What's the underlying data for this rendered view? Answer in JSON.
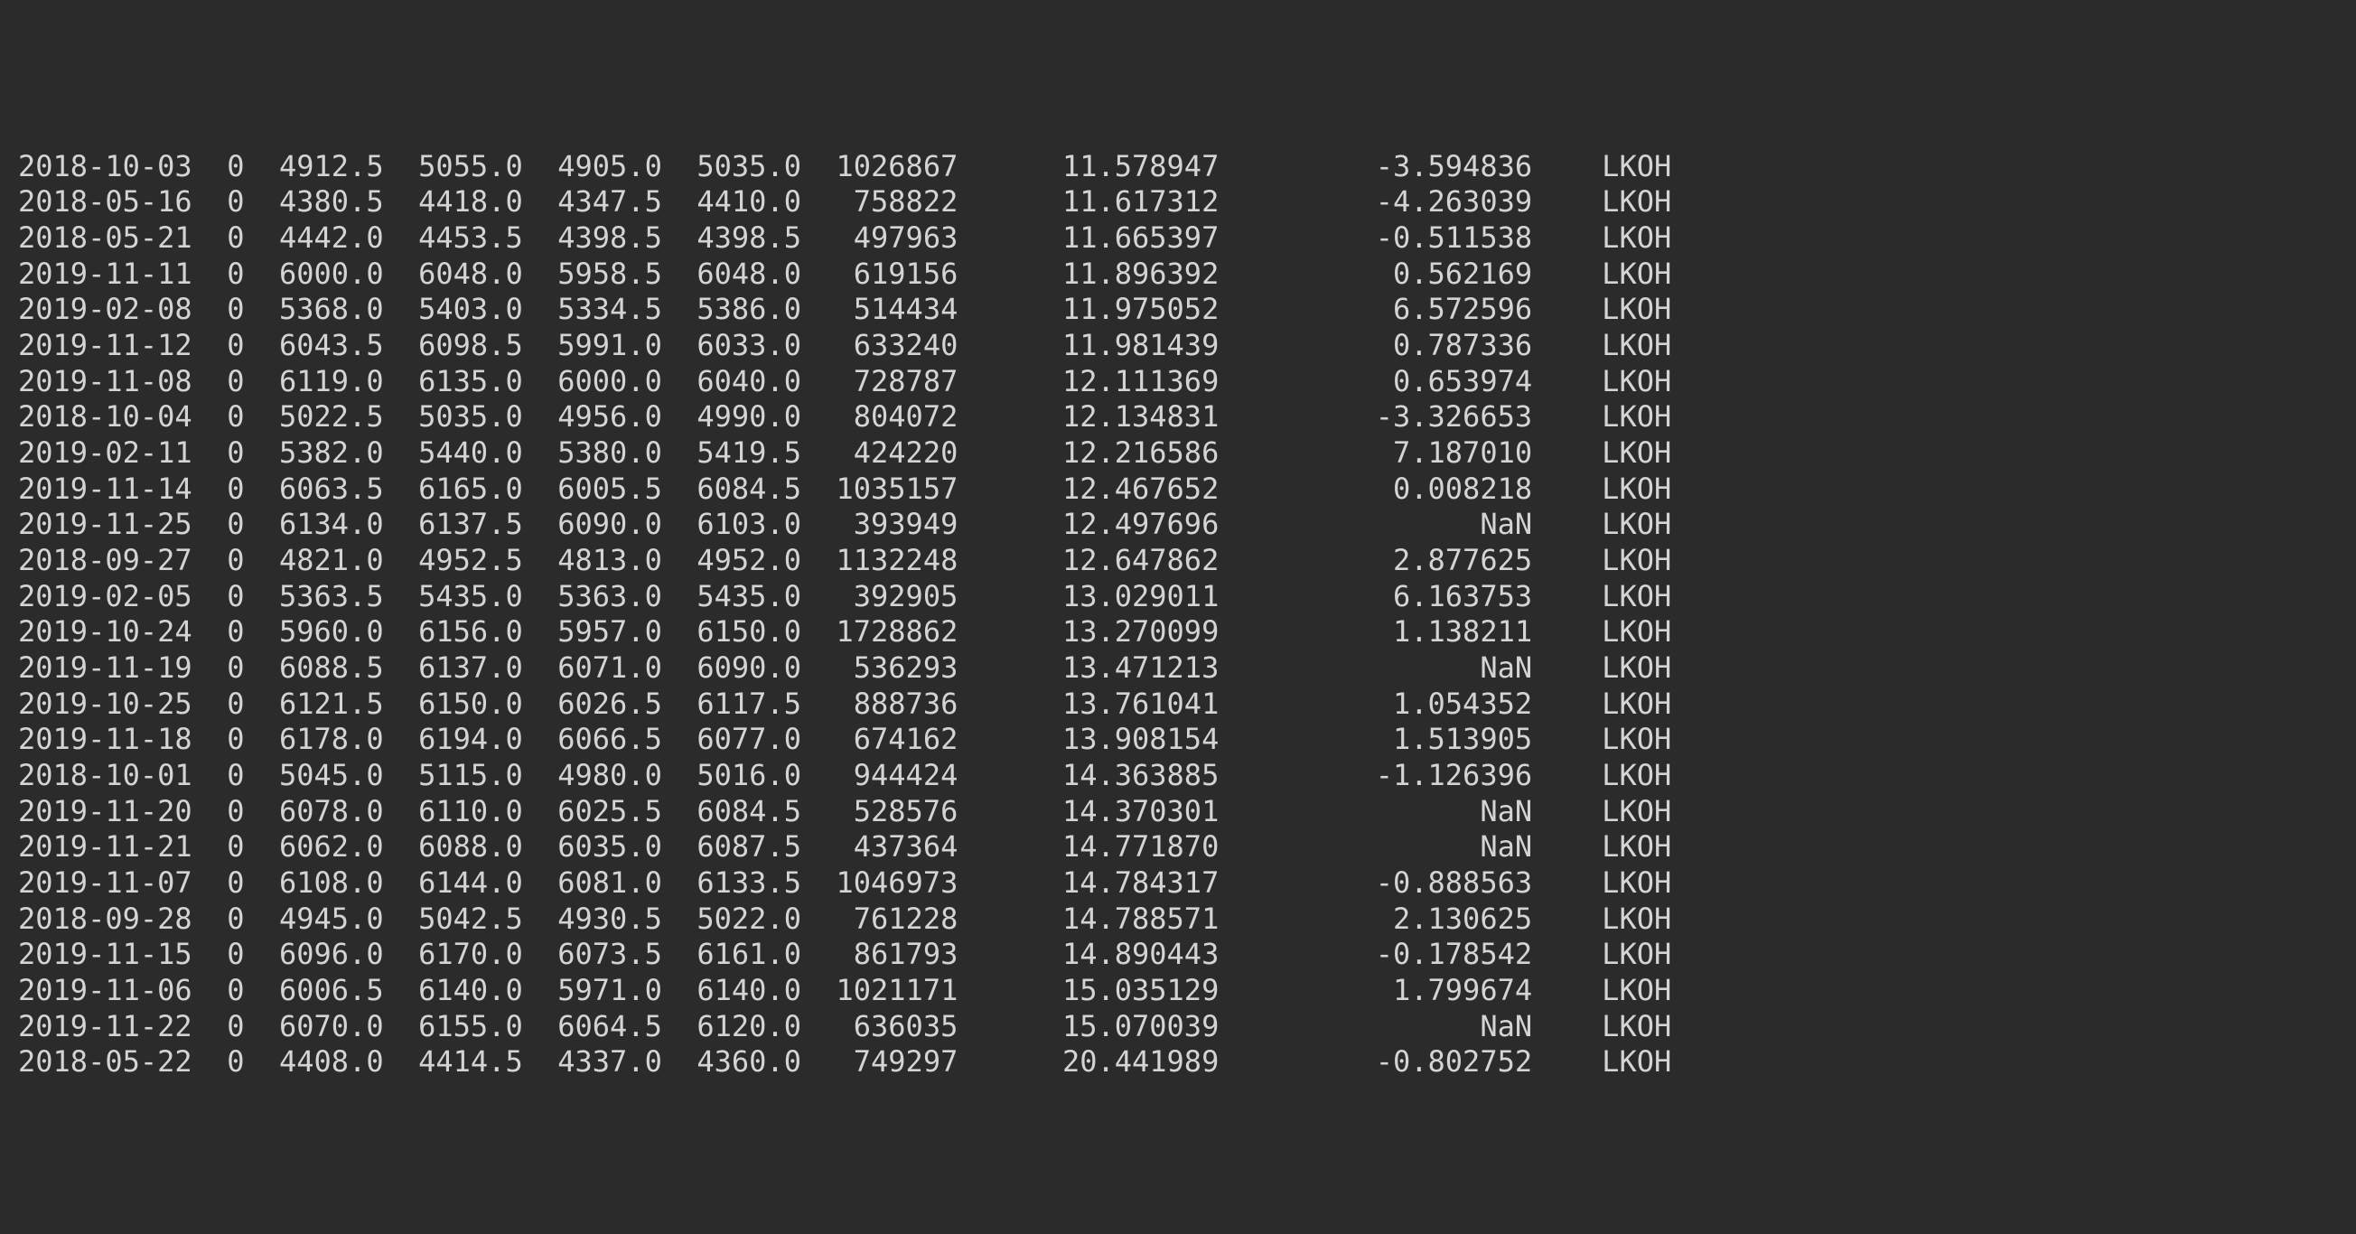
{
  "rows": [
    {
      "date": "2018-10-03",
      "flag": "0",
      "open": "4912.5",
      "high": "5055.0",
      "low": "4905.0",
      "close": "5035.0",
      "volume": "1026867",
      "colA": "11.578947",
      "colB": "-3.594836",
      "ticker": "LKOH"
    },
    {
      "date": "2018-05-16",
      "flag": "0",
      "open": "4380.5",
      "high": "4418.0",
      "low": "4347.5",
      "close": "4410.0",
      "volume": "758822",
      "colA": "11.617312",
      "colB": "-4.263039",
      "ticker": "LKOH"
    },
    {
      "date": "2018-05-21",
      "flag": "0",
      "open": "4442.0",
      "high": "4453.5",
      "low": "4398.5",
      "close": "4398.5",
      "volume": "497963",
      "colA": "11.665397",
      "colB": "-0.511538",
      "ticker": "LKOH"
    },
    {
      "date": "2019-11-11",
      "flag": "0",
      "open": "6000.0",
      "high": "6048.0",
      "low": "5958.5",
      "close": "6048.0",
      "volume": "619156",
      "colA": "11.896392",
      "colB": "0.562169",
      "ticker": "LKOH"
    },
    {
      "date": "2019-02-08",
      "flag": "0",
      "open": "5368.0",
      "high": "5403.0",
      "low": "5334.5",
      "close": "5386.0",
      "volume": "514434",
      "colA": "11.975052",
      "colB": "6.572596",
      "ticker": "LKOH"
    },
    {
      "date": "2019-11-12",
      "flag": "0",
      "open": "6043.5",
      "high": "6098.5",
      "low": "5991.0",
      "close": "6033.0",
      "volume": "633240",
      "colA": "11.981439",
      "colB": "0.787336",
      "ticker": "LKOH"
    },
    {
      "date": "2019-11-08",
      "flag": "0",
      "open": "6119.0",
      "high": "6135.0",
      "low": "6000.0",
      "close": "6040.0",
      "volume": "728787",
      "colA": "12.111369",
      "colB": "0.653974",
      "ticker": "LKOH"
    },
    {
      "date": "2018-10-04",
      "flag": "0",
      "open": "5022.5",
      "high": "5035.0",
      "low": "4956.0",
      "close": "4990.0",
      "volume": "804072",
      "colA": "12.134831",
      "colB": "-3.326653",
      "ticker": "LKOH"
    },
    {
      "date": "2019-02-11",
      "flag": "0",
      "open": "5382.0",
      "high": "5440.0",
      "low": "5380.0",
      "close": "5419.5",
      "volume": "424220",
      "colA": "12.216586",
      "colB": "7.187010",
      "ticker": "LKOH"
    },
    {
      "date": "2019-11-14",
      "flag": "0",
      "open": "6063.5",
      "high": "6165.0",
      "low": "6005.5",
      "close": "6084.5",
      "volume": "1035157",
      "colA": "12.467652",
      "colB": "0.008218",
      "ticker": "LKOH"
    },
    {
      "date": "2019-11-25",
      "flag": "0",
      "open": "6134.0",
      "high": "6137.5",
      "low": "6090.0",
      "close": "6103.0",
      "volume": "393949",
      "colA": "12.497696",
      "colB": "NaN",
      "ticker": "LKOH"
    },
    {
      "date": "2018-09-27",
      "flag": "0",
      "open": "4821.0",
      "high": "4952.5",
      "low": "4813.0",
      "close": "4952.0",
      "volume": "1132248",
      "colA": "12.647862",
      "colB": "2.877625",
      "ticker": "LKOH"
    },
    {
      "date": "2019-02-05",
      "flag": "0",
      "open": "5363.5",
      "high": "5435.0",
      "low": "5363.0",
      "close": "5435.0",
      "volume": "392905",
      "colA": "13.029011",
      "colB": "6.163753",
      "ticker": "LKOH"
    },
    {
      "date": "2019-10-24",
      "flag": "0",
      "open": "5960.0",
      "high": "6156.0",
      "low": "5957.0",
      "close": "6150.0",
      "volume": "1728862",
      "colA": "13.270099",
      "colB": "1.138211",
      "ticker": "LKOH"
    },
    {
      "date": "2019-11-19",
      "flag": "0",
      "open": "6088.5",
      "high": "6137.0",
      "low": "6071.0",
      "close": "6090.0",
      "volume": "536293",
      "colA": "13.471213",
      "colB": "NaN",
      "ticker": "LKOH"
    },
    {
      "date": "2019-10-25",
      "flag": "0",
      "open": "6121.5",
      "high": "6150.0",
      "low": "6026.5",
      "close": "6117.5",
      "volume": "888736",
      "colA": "13.761041",
      "colB": "1.054352",
      "ticker": "LKOH"
    },
    {
      "date": "2019-11-18",
      "flag": "0",
      "open": "6178.0",
      "high": "6194.0",
      "low": "6066.5",
      "close": "6077.0",
      "volume": "674162",
      "colA": "13.908154",
      "colB": "1.513905",
      "ticker": "LKOH"
    },
    {
      "date": "2018-10-01",
      "flag": "0",
      "open": "5045.0",
      "high": "5115.0",
      "low": "4980.0",
      "close": "5016.0",
      "volume": "944424",
      "colA": "14.363885",
      "colB": "-1.126396",
      "ticker": "LKOH"
    },
    {
      "date": "2019-11-20",
      "flag": "0",
      "open": "6078.0",
      "high": "6110.0",
      "low": "6025.5",
      "close": "6084.5",
      "volume": "528576",
      "colA": "14.370301",
      "colB": "NaN",
      "ticker": "LKOH"
    },
    {
      "date": "2019-11-21",
      "flag": "0",
      "open": "6062.0",
      "high": "6088.0",
      "low": "6035.0",
      "close": "6087.5",
      "volume": "437364",
      "colA": "14.771870",
      "colB": "NaN",
      "ticker": "LKOH"
    },
    {
      "date": "2019-11-07",
      "flag": "0",
      "open": "6108.0",
      "high": "6144.0",
      "low": "6081.0",
      "close": "6133.5",
      "volume": "1046973",
      "colA": "14.784317",
      "colB": "-0.888563",
      "ticker": "LKOH"
    },
    {
      "date": "2018-09-28",
      "flag": "0",
      "open": "4945.0",
      "high": "5042.5",
      "low": "4930.5",
      "close": "5022.0",
      "volume": "761228",
      "colA": "14.788571",
      "colB": "2.130625",
      "ticker": "LKOH"
    },
    {
      "date": "2019-11-15",
      "flag": "0",
      "open": "6096.0",
      "high": "6170.0",
      "low": "6073.5",
      "close": "6161.0",
      "volume": "861793",
      "colA": "14.890443",
      "colB": "-0.178542",
      "ticker": "LKOH"
    },
    {
      "date": "2019-11-06",
      "flag": "0",
      "open": "6006.5",
      "high": "6140.0",
      "low": "5971.0",
      "close": "6140.0",
      "volume": "1021171",
      "colA": "15.035129",
      "colB": "1.799674",
      "ticker": "LKOH"
    },
    {
      "date": "2019-11-22",
      "flag": "0",
      "open": "6070.0",
      "high": "6155.0",
      "low": "6064.5",
      "close": "6120.0",
      "volume": "636035",
      "colA": "15.070039",
      "colB": "NaN",
      "ticker": "LKOH"
    },
    {
      "date": "2018-05-22",
      "flag": "0",
      "open": "4408.0",
      "high": "4414.5",
      "low": "4337.0",
      "close": "4360.0",
      "volume": "749297",
      "colA": "20.441989",
      "colB": "-0.802752",
      "ticker": "LKOH"
    }
  ],
  "widths": {
    "date": 10,
    "flag": 3,
    "open": 8,
    "high": 8,
    "low": 8,
    "close": 8,
    "volume": 9,
    "colA": 15,
    "colB": 18,
    "ticker": 8
  }
}
